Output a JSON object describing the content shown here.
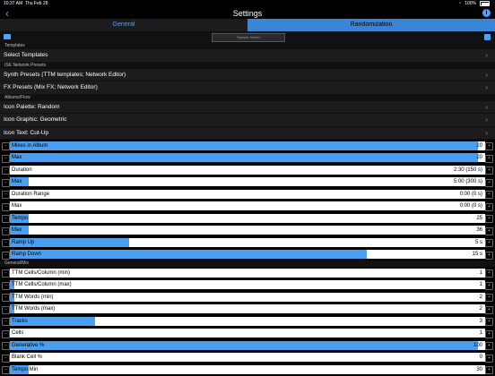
{
  "status": {
    "time": "10:37 AM",
    "date": "Thu Feb 28",
    "battery": "100%"
  },
  "nav": {
    "title": "Settings"
  },
  "tabs": [
    {
      "label": "General"
    },
    {
      "label": "Randomization"
    }
  ],
  "toolbar": {
    "segment_label": "Sample Select"
  },
  "sections": {
    "templates": "Templates",
    "ise_network_presets": "ISE Network Presets",
    "albums_flow": "Albums/Flow",
    "general_mix": "General/Mix"
  },
  "items": {
    "select_templates": "Select Templates",
    "synth_presets": "Synth Presets (TTM templates; Network Editor)",
    "fx_presets": "FX Presets (Mix FX; Network Editor)",
    "icon_palette": "Icon Palette: Random",
    "icon_graphic": "Icon Graphic: Geometric",
    "icon_text": "Icon Text: Cut-Up"
  },
  "sliders": [
    {
      "label": "Mixes in Album",
      "value": "20",
      "fill": 0.985
    },
    {
      "label": "Max",
      "value": "20",
      "fill": 0.985
    },
    {
      "label": "Duration",
      "value": "2:30 (150 s)",
      "fill": 0.0
    },
    {
      "label": "Max",
      "value": "5:00 (300 s)",
      "fill": 0.04
    },
    {
      "label": "Duration Range",
      "value": "0:00 (0 s)",
      "fill": 0.0
    },
    {
      "label": "Max",
      "value": "0:00 (0 s)",
      "fill": 0.0
    },
    {
      "label": "Tempo",
      "value": "25",
      "fill": 0.04
    },
    {
      "label": "Max",
      "value": "36",
      "fill": 0.04
    },
    {
      "label": "Ramp Up",
      "value": "5 s",
      "fill": 0.25
    },
    {
      "label": "Ramp Down",
      "value": "15 s",
      "fill": 0.75
    },
    {
      "label": "TTM Cells/Column (min)",
      "value": "1",
      "fill": 0.0
    },
    {
      "label": "TTM Cells/Column (max)",
      "value": "1",
      "fill": 0.01
    },
    {
      "label": "TTM Words (min)",
      "value": "2",
      "fill": 0.01
    },
    {
      "label": "TTM Words (max)",
      "value": "2",
      "fill": 0.01
    },
    {
      "label": "Tracks",
      "value": "3",
      "fill": 0.18
    },
    {
      "label": "Cells",
      "value": "1",
      "fill": 0.0
    },
    {
      "label": "Generative %",
      "value": "100",
      "fill": 0.985
    },
    {
      "label": "Blank Cell %",
      "value": "0",
      "fill": 0.0
    },
    {
      "label": "Tempo Min",
      "value": "30",
      "fill": 0.04
    }
  ]
}
